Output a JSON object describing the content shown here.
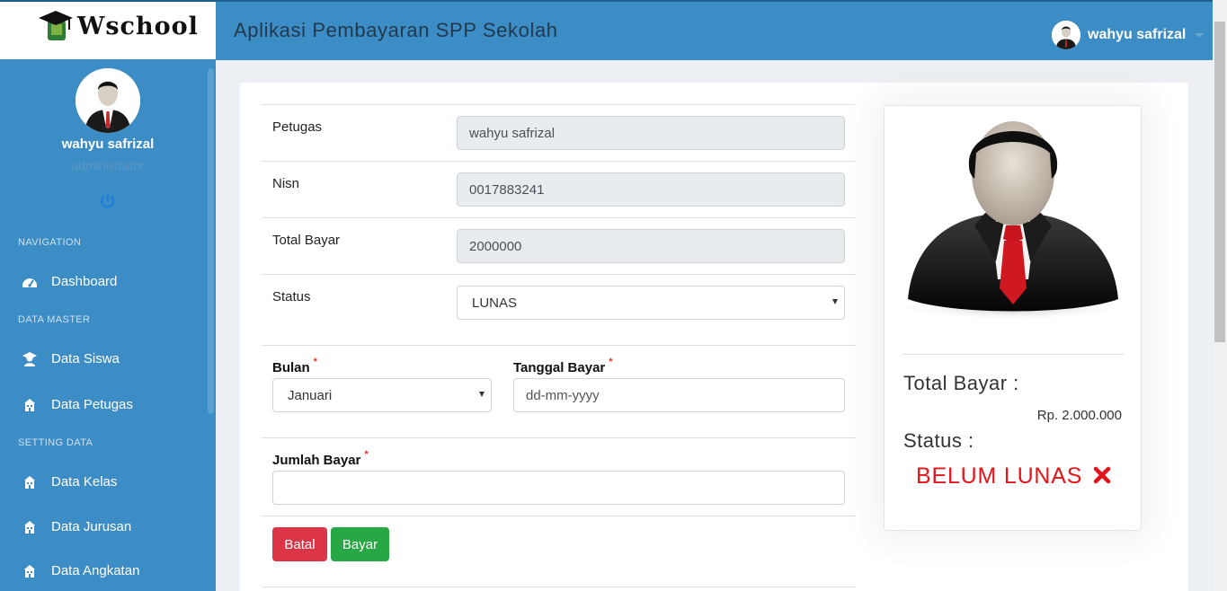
{
  "brand": {
    "name": "Wschool"
  },
  "header": {
    "title": "Aplikasi Pembayaran SPP Sekolah",
    "user_name": "wahyu safrizal"
  },
  "sidebar": {
    "user_name": "wahyu safrizal",
    "user_role": "administrator",
    "sections": [
      {
        "heading": "NAVIGATION",
        "items": [
          {
            "label": "Dashboard",
            "icon": "dashboard-icon"
          }
        ]
      },
      {
        "heading": "DATA MASTER",
        "items": [
          {
            "label": "Data Siswa",
            "icon": "student-icon"
          },
          {
            "label": "Data Petugas",
            "icon": "building-icon"
          }
        ]
      },
      {
        "heading": "SETTING DATA",
        "items": [
          {
            "label": "Data Kelas",
            "icon": "building-icon"
          },
          {
            "label": "Data Jurusan",
            "icon": "building-icon"
          },
          {
            "label": "Data Angkatan",
            "icon": "building-icon"
          }
        ]
      }
    ]
  },
  "form": {
    "petugas": {
      "label": "Petugas",
      "value": "wahyu safrizal"
    },
    "nisn": {
      "label": "Nisn",
      "value": "0017883241"
    },
    "total_bayar": {
      "label": "Total Bayar",
      "value": "2000000"
    },
    "status": {
      "label": "Status",
      "selected": "LUNAS"
    },
    "bulan": {
      "label": "Bulan",
      "required": "*",
      "selected": "Januari"
    },
    "tanggal_bayar": {
      "label": "Tanggal Bayar",
      "required": "*",
      "placeholder": "dd-mm-yyyy"
    },
    "jumlah_bayar": {
      "label": "Jumlah Bayar",
      "required": "*",
      "value": ""
    },
    "buttons": {
      "cancel": "Batal",
      "submit": "Bayar"
    }
  },
  "summary": {
    "total_label": "Total Bayar :",
    "total_value": "Rp. 2.000.000",
    "status_label": "Status :",
    "status_value": "BELUM LUNAS"
  },
  "colors": {
    "sidebar_bg": "#3c8dc5",
    "header_bg": "#3c8dc5",
    "danger": "#dc3545",
    "success": "#28a745",
    "status_unpaid": "#e3141a"
  }
}
